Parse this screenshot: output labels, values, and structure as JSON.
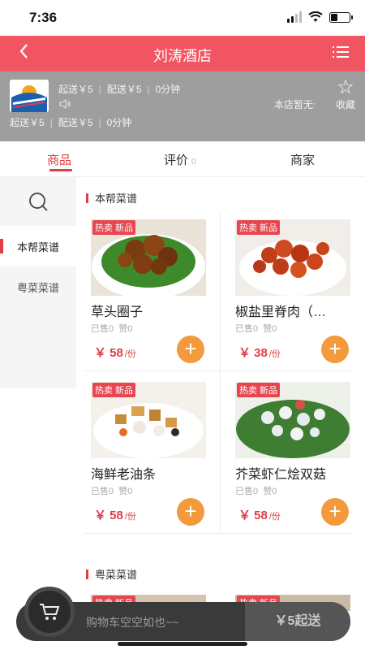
{
  "status": {
    "time": "7:36"
  },
  "header": {
    "title": "刘涛酒店",
    "back_icon": "chevron-left-icon",
    "menu_icon": "list-icon"
  },
  "shop": {
    "min_order": "起送￥5",
    "delivery_fee": "配送￥5",
    "delivery_time": "0分钟",
    "notice": "本店暂无公告",
    "favorite_label": "收藏"
  },
  "tabs": [
    {
      "label": "商品"
    },
    {
      "label": "评价",
      "count": "0"
    },
    {
      "label": "商家"
    }
  ],
  "sidebar": {
    "categories": [
      {
        "label": "本帮菜谱"
      },
      {
        "label": "粤菜菜谱"
      }
    ]
  },
  "sections": [
    {
      "title": "本帮菜谱",
      "items": [
        {
          "tag": "热卖 新品",
          "name": "草头圈子",
          "sold": "已售0",
          "likes": "赞0",
          "price": "￥ 58",
          "unit": "/份"
        },
        {
          "tag": "热卖 新品",
          "name": "椒盐里脊肉（…",
          "sold": "已售0",
          "likes": "赞0",
          "price": "￥ 38",
          "unit": "/份"
        },
        {
          "tag": "热卖 新品",
          "name": "海鲜老油条",
          "sold": "已售0",
          "likes": "赞0",
          "price": "￥ 58",
          "unit": "/份"
        },
        {
          "tag": "热卖 新品",
          "name": "芥菜虾仁烩双菇",
          "sold": "已售0",
          "likes": "赞0",
          "price": "￥ 58",
          "unit": "/份"
        }
      ]
    },
    {
      "title": "粤菜菜谱",
      "items": [
        {
          "tag": "热卖 新品"
        },
        {
          "tag": "热卖 新品"
        }
      ]
    }
  ],
  "cart": {
    "empty_text": "购物车空空如也~~",
    "checkout_label": "￥5起送"
  },
  "colors": {
    "brand": "#f25562",
    "accent": "#e23c47",
    "add_button": "#f39a3c"
  }
}
